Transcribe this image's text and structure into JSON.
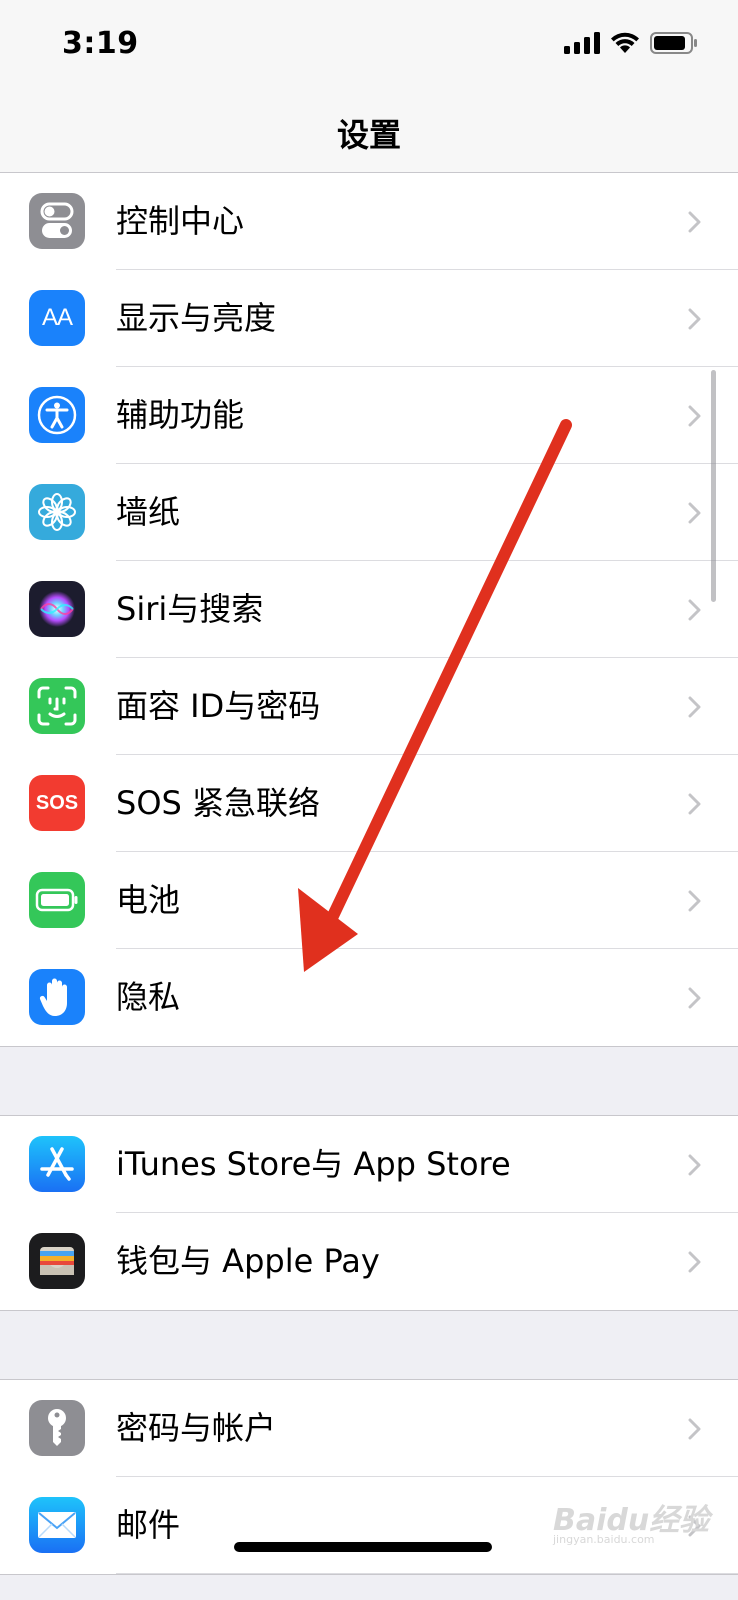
{
  "status_bar": {
    "time": "3:19"
  },
  "nav": {
    "title": "设置"
  },
  "groups": [
    {
      "items": [
        {
          "label": "控制中心",
          "icon": "control-center-icon"
        },
        {
          "label": "显示与亮度",
          "icon": "display-brightness-icon",
          "icon_text": "AA"
        },
        {
          "label": "辅助功能",
          "icon": "accessibility-icon"
        },
        {
          "label": "墙纸",
          "icon": "wallpaper-icon"
        },
        {
          "label": "Siri与搜索",
          "icon": "siri-icon"
        },
        {
          "label": "面容 ID与密码",
          "icon": "face-id-icon"
        },
        {
          "label": "SOS 紧急联络",
          "icon": "sos-icon",
          "icon_text": "SOS"
        },
        {
          "label": "电池",
          "icon": "battery-icon"
        },
        {
          "label": "隐私",
          "icon": "privacy-hand-icon"
        }
      ]
    },
    {
      "items": [
        {
          "label": "iTunes Store与 App Store",
          "icon": "app-store-icon"
        },
        {
          "label": "钱包与 Apple Pay",
          "icon": "wallet-icon"
        }
      ]
    },
    {
      "items": [
        {
          "label": "密码与帐户",
          "icon": "key-icon"
        },
        {
          "label": "邮件",
          "icon": "mail-icon"
        }
      ]
    }
  ],
  "watermark": {
    "brand": "Baidu经验",
    "sub": "jingyan.baidu.com"
  },
  "colors": {
    "annotation_arrow": "#e0301e",
    "accent_blue": "#1a82fb"
  }
}
